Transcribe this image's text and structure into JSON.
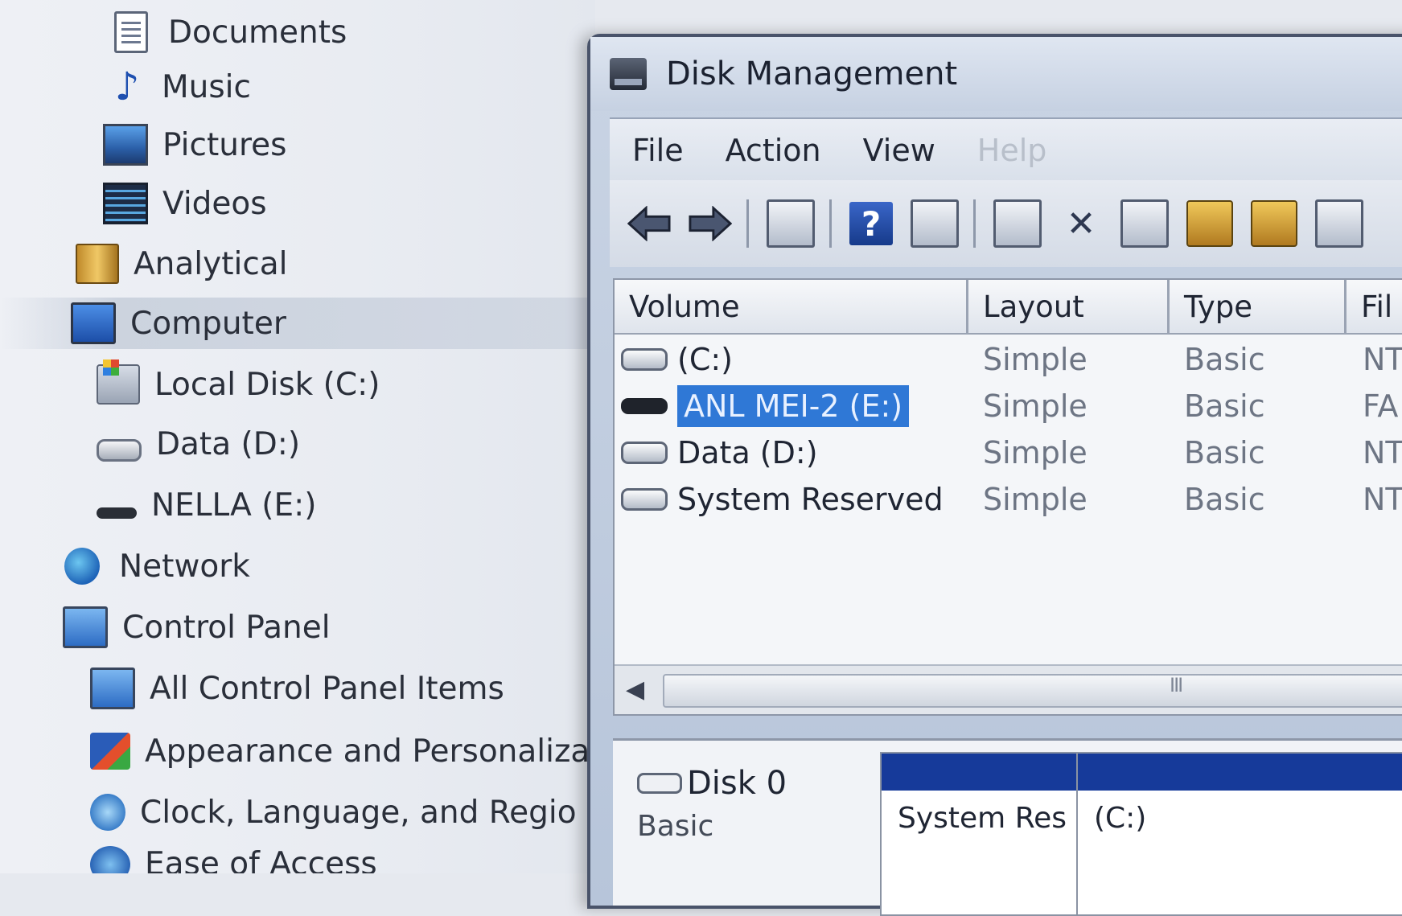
{
  "navigation": {
    "items": [
      {
        "label": "Documents",
        "icon": "documents-icon"
      },
      {
        "label": "Music",
        "icon": "music-icon"
      },
      {
        "label": "Pictures",
        "icon": "pictures-icon"
      },
      {
        "label": "Videos",
        "icon": "videos-icon"
      },
      {
        "label": "Analytical",
        "icon": "library-icon"
      },
      {
        "label": "Computer",
        "icon": "computer-icon"
      },
      {
        "label": "Local Disk (C:)",
        "icon": "local-disk-icon"
      },
      {
        "label": "Data (D:)",
        "icon": "drive-icon"
      },
      {
        "label": "NELLA (E:)",
        "icon": "usb-drive-icon"
      },
      {
        "label": "Network",
        "icon": "network-icon"
      },
      {
        "label": "Control Panel",
        "icon": "control-panel-icon"
      },
      {
        "label": "All Control Panel Items",
        "icon": "control-panel-icon"
      },
      {
        "label": "Appearance and Personaliza",
        "icon": "appearance-icon"
      },
      {
        "label": "Clock, Language, and Regio",
        "icon": "clock-icon"
      },
      {
        "label": "Ease of Access",
        "icon": "ease-of-access-icon"
      }
    ]
  },
  "window": {
    "title": "Disk Management",
    "menu": [
      "File",
      "Action",
      "View",
      "Help"
    ],
    "toolbar": [
      "back-arrow-icon",
      "forward-arrow-icon",
      "console-tree-icon",
      "help-icon",
      "action-pane-icon",
      "refresh-icon",
      "delete-icon",
      "properties-icon",
      "open-folder-icon",
      "explore-icon",
      "settings-icon"
    ]
  },
  "volumes": {
    "columns": [
      "Volume",
      "Layout",
      "Type",
      "Fil"
    ],
    "rows": [
      {
        "volume": "(C:)",
        "layout": "Simple",
        "type": "Basic",
        "fs": "NT",
        "drive": "hdd"
      },
      {
        "volume": "ANL MEI-2 (E:)",
        "layout": "Simple",
        "type": "Basic",
        "fs": "FA",
        "drive": "usb",
        "selected": true
      },
      {
        "volume": "Data (D:)",
        "layout": "Simple",
        "type": "Basic",
        "fs": "NT",
        "drive": "hdd"
      },
      {
        "volume": "System Reserved",
        "layout": "Simple",
        "type": "Basic",
        "fs": "NT",
        "drive": "hdd"
      }
    ],
    "scroll_grip": "III"
  },
  "disks": {
    "disk0": {
      "label": "Disk 0",
      "type": "Basic",
      "partitions": [
        "System Res",
        "(C:)"
      ]
    }
  }
}
